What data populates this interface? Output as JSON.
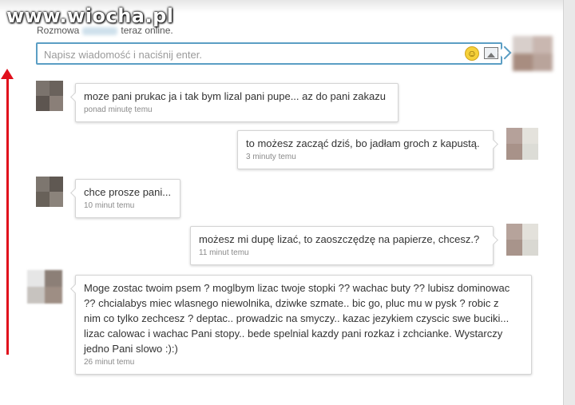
{
  "watermark": "www.wiocha.pl",
  "status": {
    "prefix": "Rozmowa",
    "suffix": "teraz online."
  },
  "compose": {
    "placeholder": "Napisz wiadomość i naciśnij enter.",
    "emoji": "☺"
  },
  "messages": [
    {
      "side": "left",
      "text": "moze pani prukac ja i tak bym lizal pani pupe... az do pani zakazu",
      "time": "ponad minutę temu"
    },
    {
      "side": "right",
      "text": "to możesz zacząć dziś, bo jadłam groch z kapustą.",
      "time": "3 minuty temu"
    },
    {
      "side": "left",
      "text": "chce prosze pani...",
      "time": "10 minut temu"
    },
    {
      "side": "right",
      "text": "możesz mi dupę lizać, to zaoszczędzę na papierze, chcesz.?",
      "time": "11 minut temu"
    },
    {
      "side": "left",
      "text": "Moge zostac twoim psem ? moglbym lizac twoje stopki ?? wachac buty ?? lubisz dominowac\n?? chcialabys miec wlasnego niewolnika, dziwke szmate.. bic go, pluc mu w pysk ? robic z\nnim co tylko zechcesz ? deptac.. prowadzic na smyczy.. kazac jezykiem czyscic swe buciki...\nlizac calowac i wachac Pani stopy.. bede spelnial kazdy pani rozkaz i zchcianke. Wystarczy\njedno Pani slowo :):)",
      "time": "26 minut temu"
    }
  ],
  "colors": {
    "accent": "#5b9ec4",
    "arrow": "#e0101c"
  }
}
